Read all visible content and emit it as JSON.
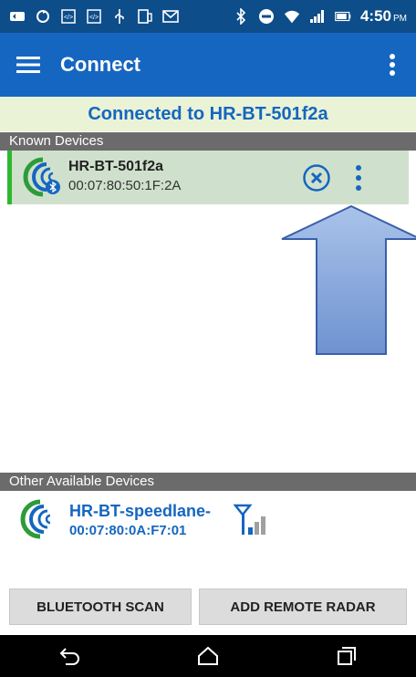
{
  "status_bar": {
    "time": "4:50",
    "ampm": "PM",
    "icons": [
      "notification-icon",
      "sync-icon",
      "code-icon",
      "code-icon",
      "usb-icon",
      "device-icon",
      "mail-icon",
      "bluetooth-icon",
      "do-not-disturb-icon",
      "wifi-icon",
      "cell-signal-icon",
      "battery-icon"
    ]
  },
  "app_bar": {
    "title": "Connect",
    "menu_icon": "hamburger-menu-icon",
    "overflow_icon": "more-vert-icon"
  },
  "banner": {
    "text": "Connected to HR-BT-501f2a"
  },
  "known_devices": {
    "header": "Known Devices",
    "items": [
      {
        "name": "HR-BT-501f2a",
        "mac": "00:07:80:50:1F:2A",
        "icon": "radar-bluetooth-icon",
        "status": "connected"
      }
    ]
  },
  "other_devices": {
    "header": "Other Available Devices",
    "items": [
      {
        "name": "HR-BT-speedlane-",
        "mac": "00:07:80:0A:F7:01",
        "icon": "radar-icon",
        "signal": "signal-strength-icon"
      }
    ]
  },
  "buttons": {
    "scan": "BLUETOOTH SCAN",
    "remote": "ADD REMOTE RADAR"
  },
  "colors": {
    "status_bar": "#0d4d8a",
    "app_bar": "#1566c0",
    "banner_bg": "#eaf3d6",
    "accent_blue": "#1566c0",
    "connected_green": "#2eb82e",
    "section_header": "#6b6b6b"
  }
}
